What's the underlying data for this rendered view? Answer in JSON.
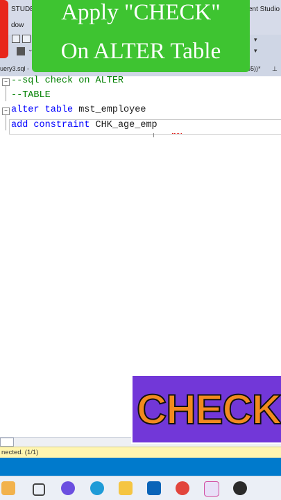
{
  "app": {
    "title_left_fragment": "STUDE",
    "title_right_fragment": "ent Studio",
    "menu_fragment": "dow",
    "tab_label": "uery3.sql -",
    "tab_right_fragment": "55))*"
  },
  "overlay": {
    "line1": "Apply \"CHECK\"",
    "line2": "On ALTER Table",
    "badge": "CHECK"
  },
  "editor": {
    "lines": [
      {
        "kind": "comment",
        "text": "--sql check on ALTER"
      },
      {
        "kind": "comment",
        "text": "--TABLE"
      },
      {
        "kind": "code",
        "keyword1": "alter",
        "keyword2": "table",
        "rest": " mst_employee"
      },
      {
        "kind": "code",
        "keyword1": "add",
        "keyword2": "constraint",
        "rest": " CHK_age_emp"
      }
    ]
  },
  "status": {
    "text": "nected. (1/1)"
  },
  "colors": {
    "green_overlay": "#3ec431",
    "purple_card": "#7237d8",
    "check_orange": "#f28a1e",
    "keyword_blue": "#0000ff",
    "comment_green": "#008000",
    "statusbar_blue": "#007acc",
    "status_yellow": "#fff5b0"
  },
  "taskbar": {
    "icons": [
      "widgets-icon",
      "task-view-icon",
      "copilot-icon",
      "edge-icon",
      "file-explorer-icon",
      "outlook-icon",
      "chrome-icon",
      "snipping-tool-icon",
      "app-icon"
    ]
  }
}
